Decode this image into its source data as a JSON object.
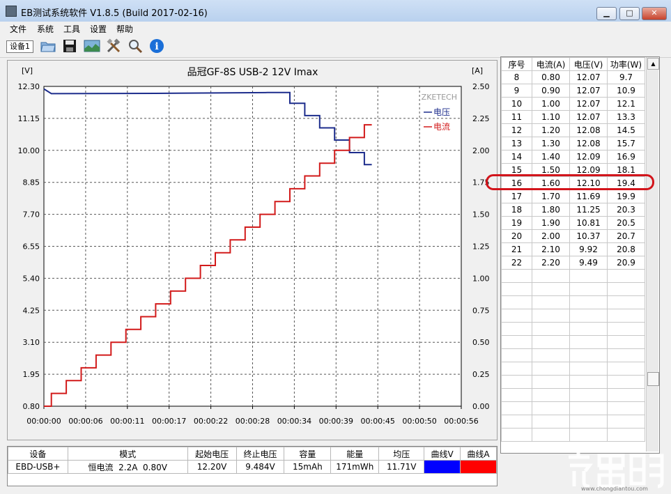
{
  "window": {
    "title": "EB测试系统软件 V1.8.5 (Build 2017-02-16)",
    "minimize": "▁",
    "maximize": "□",
    "close": "✕"
  },
  "menu": [
    "文件",
    "系统",
    "工具",
    "设置",
    "帮助"
  ],
  "toolbar": {
    "device_tab": "设备1",
    "buttons": [
      "open-folder-icon",
      "save-icon",
      "chart-image-icon",
      "tools-icon",
      "search-icon",
      "info-icon"
    ]
  },
  "chart_data": {
    "type": "line",
    "title": "品冠GF-8S USB-2  12V Imax",
    "watermark": "ZKETECH",
    "left_unit": "[V]",
    "right_unit": "[A]",
    "left_ticks": [
      "12.30",
      "11.15",
      "10.00",
      "8.85",
      "7.70",
      "6.55",
      "5.40",
      "4.25",
      "3.10",
      "1.95",
      "0.80"
    ],
    "right_ticks": [
      "2.50",
      "2.25",
      "2.00",
      "1.75",
      "1.50",
      "1.25",
      "1.00",
      "0.75",
      "0.50",
      "0.25",
      "0.00"
    ],
    "x_ticks": [
      "00:00:00",
      "00:00:06",
      "00:00:11",
      "00:00:17",
      "00:00:22",
      "00:00:28",
      "00:00:34",
      "00:00:39",
      "00:00:45",
      "00:00:50",
      "00:00:56"
    ],
    "ylim_left": [
      0.8,
      12.3
    ],
    "ylim_right": [
      0.0,
      2.5
    ],
    "xlim_seconds": [
      0,
      56
    ],
    "grid": true,
    "legend_position": "top-right",
    "series": [
      {
        "name": "电压",
        "axis": "left",
        "color": "#1c2c8c",
        "points": [
          [
            0,
            12.21
          ],
          [
            1,
            12.04
          ],
          [
            15,
            12.05
          ],
          [
            30,
            12.08
          ],
          [
            33,
            12.08
          ],
          [
            33,
            11.69
          ],
          [
            35,
            11.69
          ],
          [
            35,
            11.25
          ],
          [
            37,
            11.25
          ],
          [
            37,
            10.81
          ],
          [
            39,
            10.81
          ],
          [
            39,
            10.37
          ],
          [
            41,
            10.37
          ],
          [
            41,
            9.92
          ],
          [
            43,
            9.92
          ],
          [
            43,
            9.49
          ],
          [
            44,
            9.49
          ]
        ]
      },
      {
        "name": "电流",
        "axis": "right",
        "color": "#d21a1a",
        "points": [
          [
            0,
            0.0
          ],
          [
            1,
            0.0
          ],
          [
            1,
            0.1
          ],
          [
            3,
            0.1
          ],
          [
            3,
            0.2
          ],
          [
            5,
            0.2
          ],
          [
            5,
            0.3
          ],
          [
            7,
            0.3
          ],
          [
            7,
            0.4
          ],
          [
            9,
            0.4
          ],
          [
            9,
            0.5
          ],
          [
            11,
            0.5
          ],
          [
            11,
            0.6
          ],
          [
            13,
            0.6
          ],
          [
            13,
            0.7
          ],
          [
            15,
            0.7
          ],
          [
            15,
            0.8
          ],
          [
            17,
            0.8
          ],
          [
            17,
            0.9
          ],
          [
            19,
            0.9
          ],
          [
            19,
            1.0
          ],
          [
            21,
            1.0
          ],
          [
            21,
            1.1
          ],
          [
            23,
            1.1
          ],
          [
            23,
            1.2
          ],
          [
            25,
            1.2
          ],
          [
            25,
            1.3
          ],
          [
            27,
            1.3
          ],
          [
            27,
            1.4
          ],
          [
            29,
            1.4
          ],
          [
            29,
            1.5
          ],
          [
            31,
            1.5
          ],
          [
            31,
            1.6
          ],
          [
            33,
            1.6
          ],
          [
            33,
            1.7
          ],
          [
            35,
            1.7
          ],
          [
            35,
            1.8
          ],
          [
            37,
            1.8
          ],
          [
            37,
            1.9
          ],
          [
            39,
            1.9
          ],
          [
            39,
            2.0
          ],
          [
            41,
            2.0
          ],
          [
            41,
            2.1
          ],
          [
            43,
            2.1
          ],
          [
            43,
            2.2
          ],
          [
            44,
            2.2
          ]
        ]
      }
    ]
  },
  "table": {
    "headers": [
      "序号",
      "电流(A)",
      "电压(V)",
      "功率(W)"
    ],
    "rows": [
      [
        "8",
        "0.80",
        "12.07",
        "9.7"
      ],
      [
        "9",
        "0.90",
        "12.07",
        "10.9"
      ],
      [
        "10",
        "1.00",
        "12.07",
        "12.1"
      ],
      [
        "11",
        "1.10",
        "12.07",
        "13.3"
      ],
      [
        "12",
        "1.20",
        "12.08",
        "14.5"
      ],
      [
        "13",
        "1.30",
        "12.08",
        "15.7"
      ],
      [
        "14",
        "1.40",
        "12.09",
        "16.9"
      ],
      [
        "15",
        "1.50",
        "12.09",
        "18.1"
      ],
      [
        "16",
        "1.60",
        "12.10",
        "19.4"
      ],
      [
        "17",
        "1.70",
        "11.69",
        "19.9"
      ],
      [
        "18",
        "1.80",
        "11.25",
        "20.3"
      ],
      [
        "19",
        "1.90",
        "10.81",
        "20.5"
      ],
      [
        "20",
        "2.00",
        "10.37",
        "20.7"
      ],
      [
        "21",
        "2.10",
        "9.92",
        "20.8"
      ],
      [
        "22",
        "2.20",
        "9.49",
        "20.9"
      ]
    ],
    "highlighted_row": "16",
    "highlight_color": "#d2141b"
  },
  "summary": {
    "headers": [
      "设备",
      "模式",
      "起始电压",
      "终止电压",
      "容量",
      "能量",
      "均压",
      "曲线V",
      "曲线A"
    ],
    "values": [
      "EBD-USB+",
      "恒电流  2.2A  0.80V",
      "12.20V",
      "9.484V",
      "15mAh",
      "171mWh",
      "11.71V"
    ],
    "curve_v_color": "#0000ff",
    "curve_a_color": "#ff0000"
  },
  "watermark": {
    "site": "www.chongdiantou.com"
  }
}
